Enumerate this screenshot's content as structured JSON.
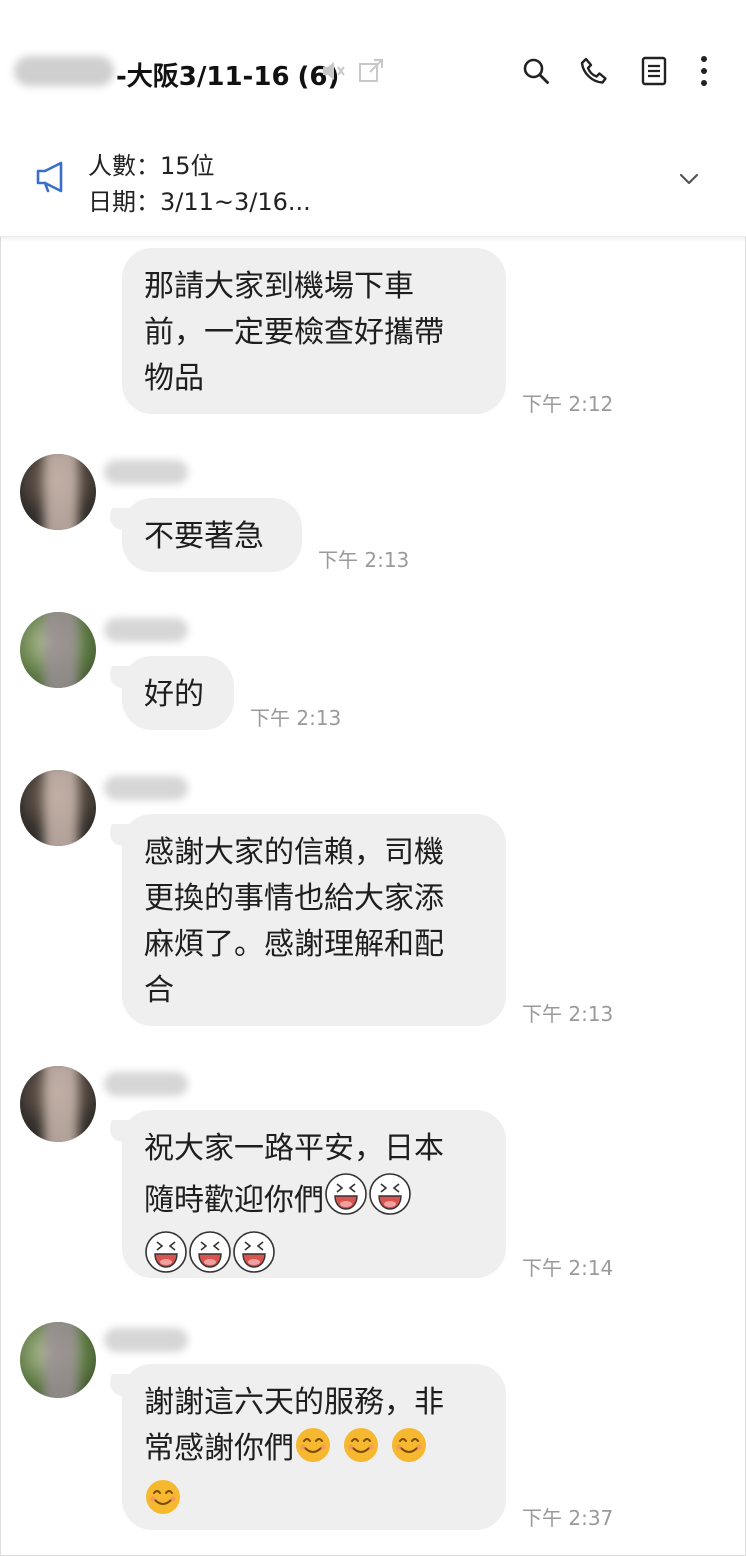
{
  "header": {
    "title": "-大阪3/11-16",
    "member_count": "(6)"
  },
  "notice": {
    "line1": "人數：15位",
    "line2": "日期：3/11~3/16..."
  },
  "messages": [
    {
      "sender": "self",
      "lines": [
        "那請大家到機場下車",
        "前，一定要檢查好攜帶",
        "物品"
      ],
      "time": "下午 2:12"
    },
    {
      "sender": "other",
      "lines": [
        "不要著急"
      ],
      "time": "下午 2:13"
    },
    {
      "sender": "other",
      "lines": [
        "好的"
      ],
      "time": "下午 2:13"
    },
    {
      "sender": "other",
      "lines": [
        "感謝大家的信賴，司機",
        "更換的事情也給大家添",
        "麻煩了。感謝理解和配",
        "合"
      ],
      "time": "下午 2:13"
    },
    {
      "sender": "other",
      "lines": [
        "祝大家一路平安，日本",
        "隨時歡迎你們"
      ],
      "time": "下午 2:14"
    },
    {
      "sender": "other",
      "lines": [
        "謝謝這六天的服務，非",
        "常感謝你們"
      ],
      "time": "下午 2:37"
    }
  ],
  "icons": {
    "mute": "speaker-muted-icon",
    "popout": "popout-icon",
    "search": "search-icon",
    "call": "phone-icon",
    "notes": "notes-icon",
    "more": "more-vertical-icon",
    "announcement": "megaphone-icon",
    "expand": "chevron-down-icon",
    "laugh_emoji": "laughing-face-emoji",
    "smile_emoji": "smiling-face-emoji"
  },
  "colors": {
    "bubble": "#efefef",
    "megaphone": "#3a6fc9",
    "timestamp": "#9a9a9a",
    "emoji_face": "#f5b82e"
  }
}
